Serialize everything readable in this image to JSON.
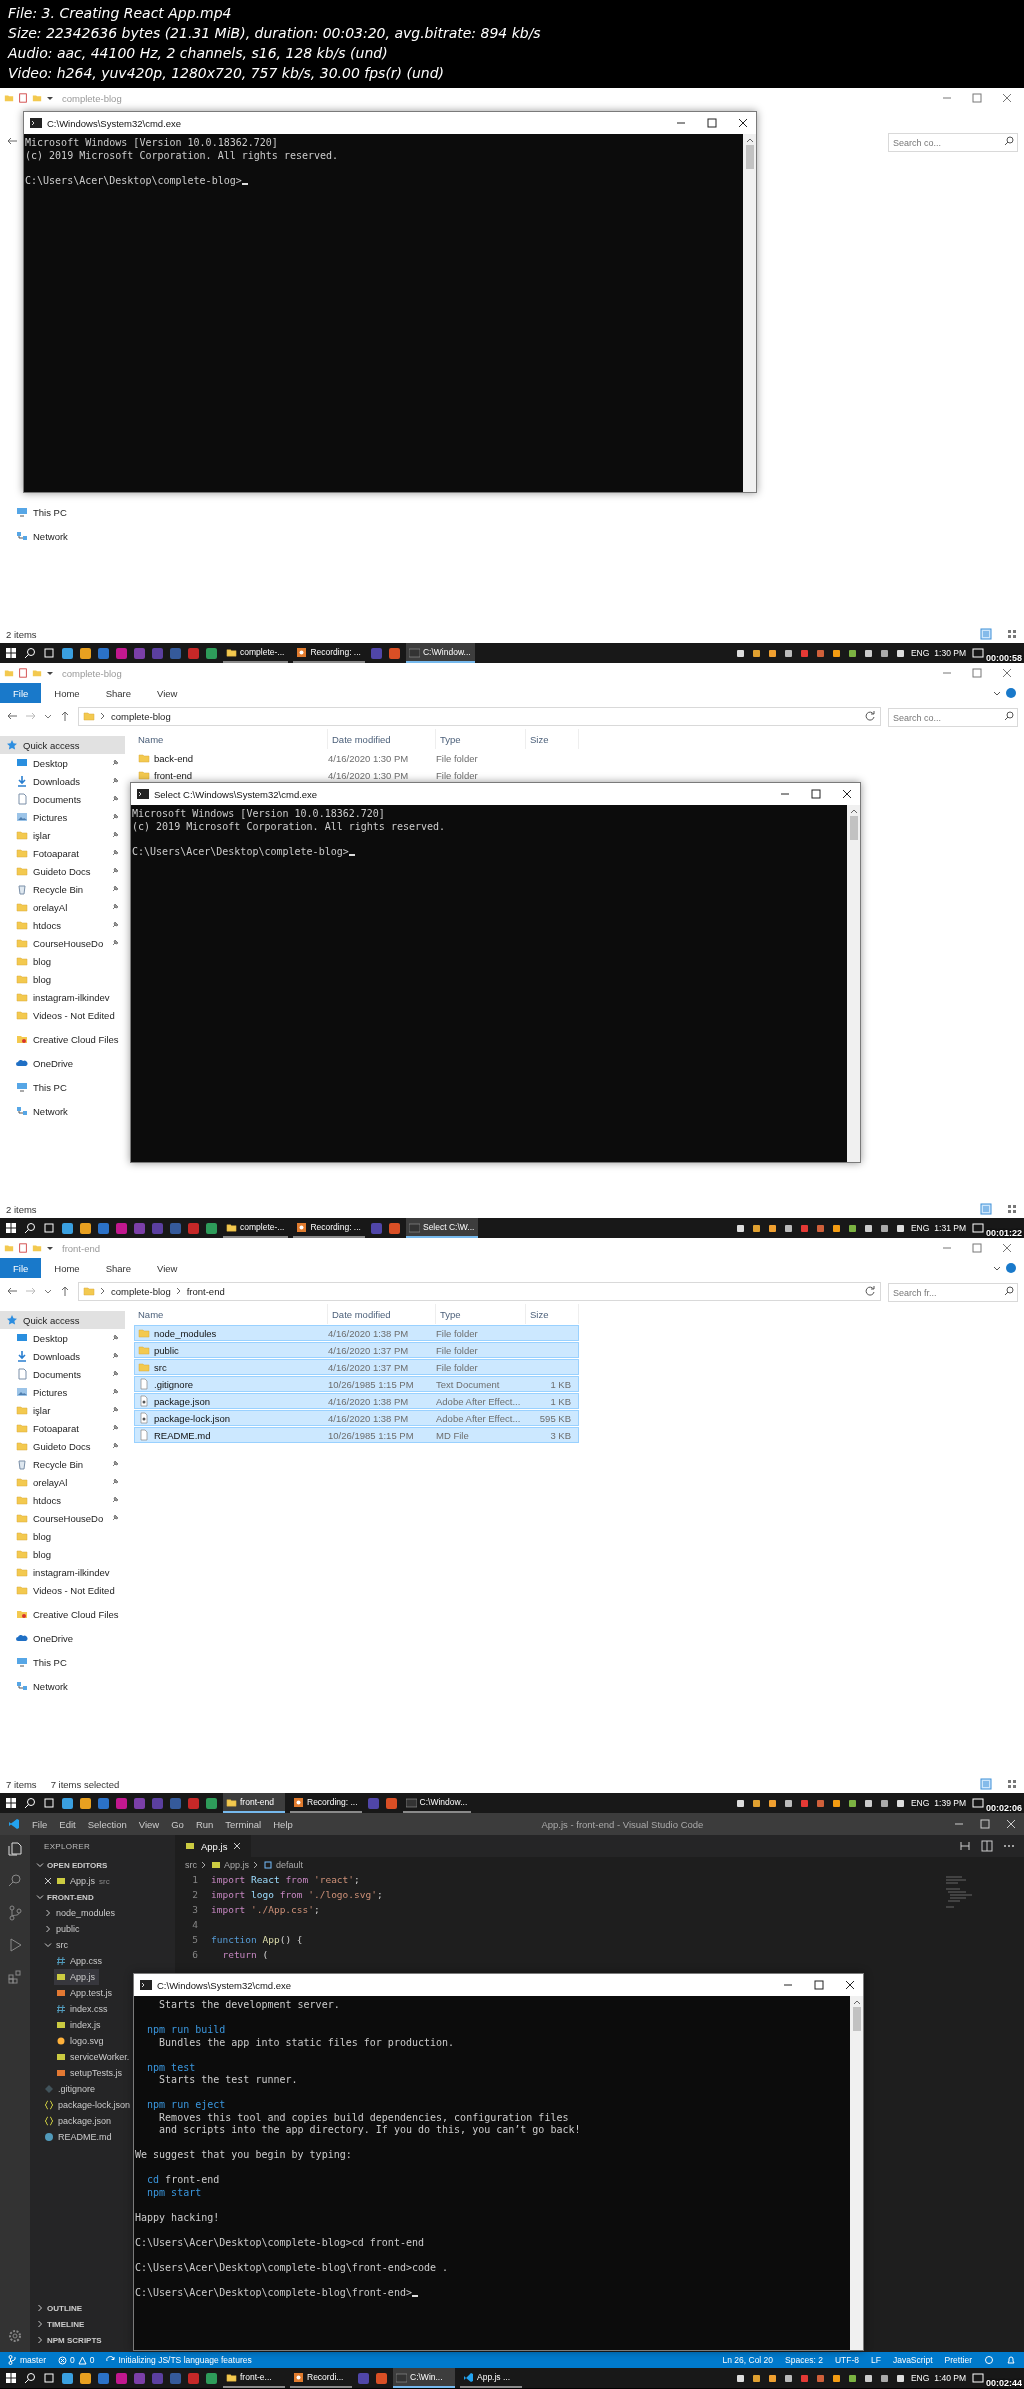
{
  "header": {
    "lines": [
      "File: 3. Creating React App.mp4",
      "Size: 22342636 bytes (21.31 MiB), duration: 00:03:20, avg.bitrate: 894 kb/s",
      "Audio: aac, 44100 Hz, 2 channels, s16, 128 kb/s (und)",
      "Video: h264, yuv420p, 1280x720, 757 kb/s, 30.00 fps(r) (und)"
    ]
  },
  "frames": [
    {
      "kind": "explorer",
      "title": "complete-blog",
      "search": {
        "placeholder": "Search co..."
      },
      "sidebar": [
        {
          "label": "This PC",
          "kind": "pc",
          "pinned": false,
          "selected": false
        },
        {
          "label": "Network",
          "kind": "network",
          "pinned": false,
          "selected": false
        }
      ],
      "status": [
        "2 items"
      ],
      "cmd": {
        "title": "C:\\Windows\\System32\\cmd.exe",
        "blocks": [
          [
            {
              "text": "Microsoft Windows [Version 10.0.18362.720]",
              "kind": "output"
            },
            {
              "text": "(c) 2019 Microsoft Corporation. All rights reserved.",
              "kind": "output"
            }
          ]
        ],
        "prompt": {
          "text": "C:\\Users\\Acer\\Desktop\\complete-blog>",
          "cursor": true
        }
      },
      "taskbar": {
        "windows": [
          {
            "label": "complete-...",
            "kind": "explorer",
            "selected": false
          },
          {
            "label": "Recording: ...",
            "kind": "recorder",
            "selected": false
          },
          {
            "label": "C:\\Window...",
            "kind": "cmd",
            "selected": true
          }
        ],
        "language": "ENG",
        "time": "1:30 PM",
        "timestamp": "00:00:58"
      }
    },
    {
      "kind": "explorer",
      "title": "complete-blog",
      "ribbon_tabs": [
        {
          "label": "File",
          "kind": "file"
        },
        {
          "label": "Home",
          "kind": "tab"
        },
        {
          "label": "Share",
          "kind": "tab"
        },
        {
          "label": "View",
          "kind": "tab"
        }
      ],
      "crumbs": [
        "complete-blog"
      ],
      "search": {
        "placeholder": "Search co..."
      },
      "columns": [
        "Name",
        "Date modified",
        "Type",
        "Size"
      ],
      "files": [
        {
          "name": "back-end",
          "date": "4/16/2020 1:30 PM",
          "type": "File folder",
          "kind": "folder",
          "selected": false
        },
        {
          "name": "front-end",
          "date": "4/16/2020 1:30 PM",
          "type": "File folder",
          "kind": "folder",
          "selected": false
        }
      ],
      "sidebar": [
        {
          "label": "Quick access",
          "kind": "quick-access",
          "pinned": false,
          "selected": true
        },
        {
          "label": "Desktop",
          "kind": "desktop",
          "pinned": true,
          "selected": false
        },
        {
          "label": "Downloads",
          "kind": "downloads",
          "pinned": true,
          "selected": false
        },
        {
          "label": "Documents",
          "kind": "documents",
          "pinned": true,
          "selected": false
        },
        {
          "label": "Pictures",
          "kind": "pictures",
          "pinned": true,
          "selected": false
        },
        {
          "label": "işlar",
          "kind": "folder",
          "pinned": true,
          "selected": false
        },
        {
          "label": "Fotoaparat",
          "kind": "folder",
          "pinned": true,
          "selected": false
        },
        {
          "label": "Guideto Docs",
          "kind": "folder",
          "pinned": true,
          "selected": false
        },
        {
          "label": "Recycle Bin",
          "kind": "recycle",
          "pinned": true,
          "selected": false
        },
        {
          "label": "orelayAl",
          "kind": "folder",
          "pinned": true,
          "selected": false
        },
        {
          "label": "htdocs",
          "kind": "folder",
          "pinned": true,
          "selected": false
        },
        {
          "label": "CourseHouseDo",
          "kind": "folder",
          "pinned": true,
          "selected": false
        },
        {
          "label": "blog",
          "kind": "folder",
          "pinned": false,
          "selected": false
        },
        {
          "label": "blog",
          "kind": "folder",
          "pinned": false,
          "selected": false
        },
        {
          "label": "instagram-ilkindev",
          "kind": "folder",
          "pinned": false,
          "selected": false
        },
        {
          "label": "Videos - Not Edited",
          "kind": "folder",
          "pinned": false,
          "selected": false
        },
        {
          "label": "Creative Cloud Files",
          "kind": "cloud",
          "pinned": false,
          "selected": false
        },
        {
          "label": "OneDrive",
          "kind": "onedrive",
          "pinned": false,
          "selected": false
        },
        {
          "label": "This PC",
          "kind": "pc",
          "pinned": false,
          "selected": false
        },
        {
          "label": "Network",
          "kind": "network",
          "pinned": false,
          "selected": false
        }
      ],
      "status": [
        "2 items"
      ],
      "cmd": {
        "title": "Select C:\\Windows\\System32\\cmd.exe",
        "blocks": [
          [
            {
              "text": "Microsoft Windows [Version 10.0.18362.720]",
              "kind": "output"
            },
            {
              "text": "(c) 2019 Microsoft Corporation. All rights reserved.",
              "kind": "output"
            }
          ]
        ],
        "prompt": {
          "text": "C:\\Users\\Acer\\Desktop\\complete-blog>",
          "cursor": true
        }
      },
      "taskbar": {
        "windows": [
          {
            "label": "complete-...",
            "kind": "explorer",
            "selected": false
          },
          {
            "label": "Recording: ...",
            "kind": "recorder",
            "selected": false
          },
          {
            "label": "Select C:\\W...",
            "kind": "cmd",
            "selected": true
          }
        ],
        "language": "ENG",
        "time": "1:31 PM",
        "timestamp": "00:01:22"
      }
    },
    {
      "kind": "explorer",
      "title": "front-end",
      "ribbon_tabs": [
        {
          "label": "File",
          "kind": "file"
        },
        {
          "label": "Home",
          "kind": "tab"
        },
        {
          "label": "Share",
          "kind": "tab"
        },
        {
          "label": "View",
          "kind": "tab"
        }
      ],
      "crumbs": [
        "complete-blog",
        "front-end"
      ],
      "search": {
        "placeholder": "Search fr..."
      },
      "columns": [
        "Name",
        "Date modified",
        "Type",
        "Size"
      ],
      "files": [
        {
          "name": "node_modules",
          "date": "4/16/2020 1:38 PM",
          "type": "File folder",
          "kind": "folder",
          "selected": true
        },
        {
          "name": "public",
          "date": "4/16/2020 1:37 PM",
          "type": "File folder",
          "kind": "folder",
          "selected": true
        },
        {
          "name": "src",
          "date": "4/16/2020 1:37 PM",
          "type": "File folder",
          "kind": "folder",
          "selected": true
        },
        {
          "name": ".gitignore",
          "date": "10/26/1985 1:15 PM",
          "type": "Text Document",
          "size": "1 KB",
          "kind": "text",
          "selected": true
        },
        {
          "name": "package.json",
          "date": "4/16/2020 1:38 PM",
          "type": "Adobe After Effect...",
          "size": "1 KB",
          "kind": "json",
          "selected": true
        },
        {
          "name": "package-lock.json",
          "date": "4/16/2020 1:38 PM",
          "type": "Adobe After Effect...",
          "size": "595 KB",
          "kind": "json",
          "selected": true
        },
        {
          "name": "README.md",
          "date": "10/26/1985 1:15 PM",
          "type": "MD File",
          "size": "3 KB",
          "kind": "text",
          "selected": true
        }
      ],
      "sidebar": [
        {
          "label": "Quick access",
          "kind": "quick-access",
          "pinned": false,
          "selected": true
        },
        {
          "label": "Desktop",
          "kind": "desktop",
          "pinned": true,
          "selected": false
        },
        {
          "label": "Downloads",
          "kind": "downloads",
          "pinned": true,
          "selected": false
        },
        {
          "label": "Documents",
          "kind": "documents",
          "pinned": true,
          "selected": false
        },
        {
          "label": "Pictures",
          "kind": "pictures",
          "pinned": true,
          "selected": false
        },
        {
          "label": "işlar",
          "kind": "folder",
          "pinned": true,
          "selected": false
        },
        {
          "label": "Fotoaparat",
          "kind": "folder",
          "pinned": true,
          "selected": false
        },
        {
          "label": "Guideto Docs",
          "kind": "folder",
          "pinned": true,
          "selected": false
        },
        {
          "label": "Recycle Bin",
          "kind": "recycle",
          "pinned": true,
          "selected": false
        },
        {
          "label": "orelayAl",
          "kind": "folder",
          "pinned": true,
          "selected": false
        },
        {
          "label": "htdocs",
          "kind": "folder",
          "pinned": true,
          "selected": false
        },
        {
          "label": "CourseHouseDo",
          "kind": "folder",
          "pinned": true,
          "selected": false
        },
        {
          "label": "blog",
          "kind": "folder",
          "pinned": false,
          "selected": false
        },
        {
          "label": "blog",
          "kind": "folder",
          "pinned": false,
          "selected": false
        },
        {
          "label": "instagram-ilkindev",
          "kind": "folder",
          "pinned": false,
          "selected": false
        },
        {
          "label": "Videos - Not Edited",
          "kind": "folder",
          "pinned": false,
          "selected": false
        },
        {
          "label": "Creative Cloud Files",
          "kind": "cloud",
          "pinned": false,
          "selected": false
        },
        {
          "label": "OneDrive",
          "kind": "onedrive",
          "pinned": false,
          "selected": false
        },
        {
          "label": "This PC",
          "kind": "pc",
          "pinned": false,
          "selected": false
        },
        {
          "label": "Network",
          "kind": "network",
          "pinned": false,
          "selected": false
        }
      ],
      "status": [
        "7 items",
        "7 items selected"
      ],
      "taskbar": {
        "windows": [
          {
            "label": "front-end",
            "kind": "explorer",
            "selected": true
          },
          {
            "label": "Recording: ...",
            "kind": "recorder",
            "selected": false
          },
          {
            "label": "C:\\Window...",
            "kind": "cmd",
            "selected": false
          }
        ],
        "language": "ENG",
        "time": "1:39 PM",
        "timestamp": "00:02:06"
      }
    },
    {
      "kind": "vscode",
      "menu": [
        "File",
        "Edit",
        "Selection",
        "View",
        "Go",
        "Run",
        "Terminal",
        "Help"
      ],
      "title": "App.js - front-end - Visual Studio Code",
      "explorer": {
        "title": "EXPLORER",
        "open_editors": {
          "label": "OPEN EDITORS",
          "expanded": true,
          "items": [
            {
              "name": "App.js",
              "folder": "src",
              "kind": "js"
            }
          ]
        },
        "project": {
          "label": "FRONT-END",
          "expanded": true,
          "tree": [
            {
              "name": "node_modules",
              "kind": "folder",
              "expanded": false,
              "selected": false
            },
            {
              "name": "public",
              "kind": "folder",
              "expanded": false,
              "selected": false
            },
            {
              "name": "src",
              "kind": "folder",
              "expanded": true,
              "selected": false,
              "children": [
                {
                  "name": "App.css",
                  "kind": "css",
                  "selected": false
                },
                {
                  "name": "App.js",
                  "kind": "js",
                  "selected": true
                },
                {
                  "name": "App.test.js",
                  "kind": "test",
                  "selected": false
                },
                {
                  "name": "index.css",
                  "kind": "css",
                  "selected": false
                },
                {
                  "name": "index.js",
                  "kind": "js",
                  "selected": false
                },
                {
                  "name": "logo.svg",
                  "kind": "svg",
                  "selected": false
                },
                {
                  "name": "serviceWorker.",
                  "kind": "js",
                  "selected": false
                },
                {
                  "name": "setupTests.js",
                  "kind": "test",
                  "selected": false
                }
              ]
            },
            {
              "name": ".gitignore",
              "kind": "git",
              "selected": false
            },
            {
              "name": "package-lock.json",
              "kind": "json",
              "selected": false
            },
            {
              "name": "package.json",
              "kind": "json",
              "selected": false
            },
            {
              "name": "README.md",
              "kind": "md",
              "selected": false
            }
          ]
        },
        "panels": [
          {
            "label": "OUTLINE",
            "expanded": false
          },
          {
            "label": "TIMELINE",
            "expanded": false
          },
          {
            "label": "NPM SCRIPTS",
            "expanded": false
          }
        ]
      },
      "tab": {
        "name": "App.js",
        "kind": "js"
      },
      "breadcrumbs": [
        {
          "label": "src",
          "kind": "folder"
        },
        {
          "label": "App.js",
          "kind": "js"
        },
        {
          "label": "default",
          "kind": "symbol"
        }
      ],
      "code": [
        {
          "number": "1",
          "tokens": [
            {
              "text": "import ",
              "kind": "keyword"
            },
            {
              "text": "React ",
              "kind": "name"
            },
            {
              "text": "from ",
              "kind": "keyword"
            },
            {
              "text": "'react'",
              "kind": "string"
            },
            {
              "text": ";",
              "kind": "plain"
            }
          ]
        },
        {
          "number": "2",
          "tokens": [
            {
              "text": "import ",
              "kind": "keyword"
            },
            {
              "text": "logo ",
              "kind": "name"
            },
            {
              "text": "from ",
              "kind": "keyword"
            },
            {
              "text": "'./logo.svg'",
              "kind": "string"
            },
            {
              "text": ";",
              "kind": "plain"
            }
          ]
        },
        {
          "number": "3",
          "tokens": [
            {
              "text": "import ",
              "kind": "keyword"
            },
            {
              "text": "'./App.css'",
              "kind": "string"
            },
            {
              "text": ";",
              "kind": "plain"
            }
          ]
        },
        {
          "number": "4"
        },
        {
          "number": "5",
          "tokens": [
            {
              "text": "function ",
              "kind": "storage"
            },
            {
              "text": "App",
              "kind": "function"
            },
            {
              "text": "() {",
              "kind": "plain"
            }
          ]
        },
        {
          "number": "6",
          "tokens": [
            {
              "text": "  return ",
              "kind": "keyword"
            },
            {
              "text": "(",
              "kind": "plain"
            }
          ]
        }
      ],
      "status_bar": {
        "branch": "master",
        "errors": "0",
        "warnings": "0",
        "message": "Initializing JS/TS language features",
        "items": [
          "Ln 26, Col 20",
          "Spaces: 2",
          "UTF-8",
          "LF",
          "JavaScript",
          "Prettier"
        ]
      },
      "cmd": {
        "title": "C:\\Windows\\System32\\cmd.exe",
        "blocks": [
          [
            {
              "text": "    Starts the development server.",
              "kind": "output"
            }
          ],
          [
            {
              "text": "  npm run build",
              "kind": "command"
            },
            {
              "text": "    Bundles the app into static files for production.",
              "kind": "output"
            }
          ],
          [
            {
              "text": "  npm test",
              "kind": "command"
            },
            {
              "text": "    Starts the test runner.",
              "kind": "output"
            }
          ],
          [
            {
              "text": "  npm run eject",
              "kind": "command"
            },
            {
              "text": "    Removes this tool and copies build dependencies, configuration files",
              "kind": "output"
            },
            {
              "text": "    and scripts into the app directory. If you do this, you can’t go back!",
              "kind": "output"
            }
          ],
          [
            {
              "text": "We suggest that you begin by typing:",
              "kind": "output"
            }
          ],
          [
            {
              "text": "  cd",
              "kind": "command",
              "tail": " front-end"
            },
            {
              "text": "  npm start",
              "kind": "command"
            }
          ],
          [
            {
              "text": "Happy hacking!",
              "kind": "output"
            }
          ],
          [
            {
              "text": "C:\\Users\\Acer\\Desktop\\complete-blog>cd front-end",
              "kind": "output"
            }
          ],
          [
            {
              "text": "C:\\Users\\Acer\\Desktop\\complete-blog\\front-end>code .",
              "kind": "output"
            }
          ]
        ],
        "prompt": {
          "text": "C:\\Users\\Acer\\Desktop\\complete-blog\\front-end>",
          "cursor": true
        }
      },
      "taskbar": {
        "windows": [
          {
            "label": "front-e...",
            "kind": "explorer",
            "selected": false
          },
          {
            "label": "Recordi...",
            "kind": "recorder",
            "selected": false
          },
          {
            "label": "C:\\Win...",
            "kind": "cmd",
            "selected": true
          },
          {
            "label": "App.js ...",
            "kind": "vscode",
            "selected": false
          }
        ],
        "language": "ENG",
        "time": "1:40 PM",
        "timestamp": "00:02:44"
      }
    }
  ]
}
